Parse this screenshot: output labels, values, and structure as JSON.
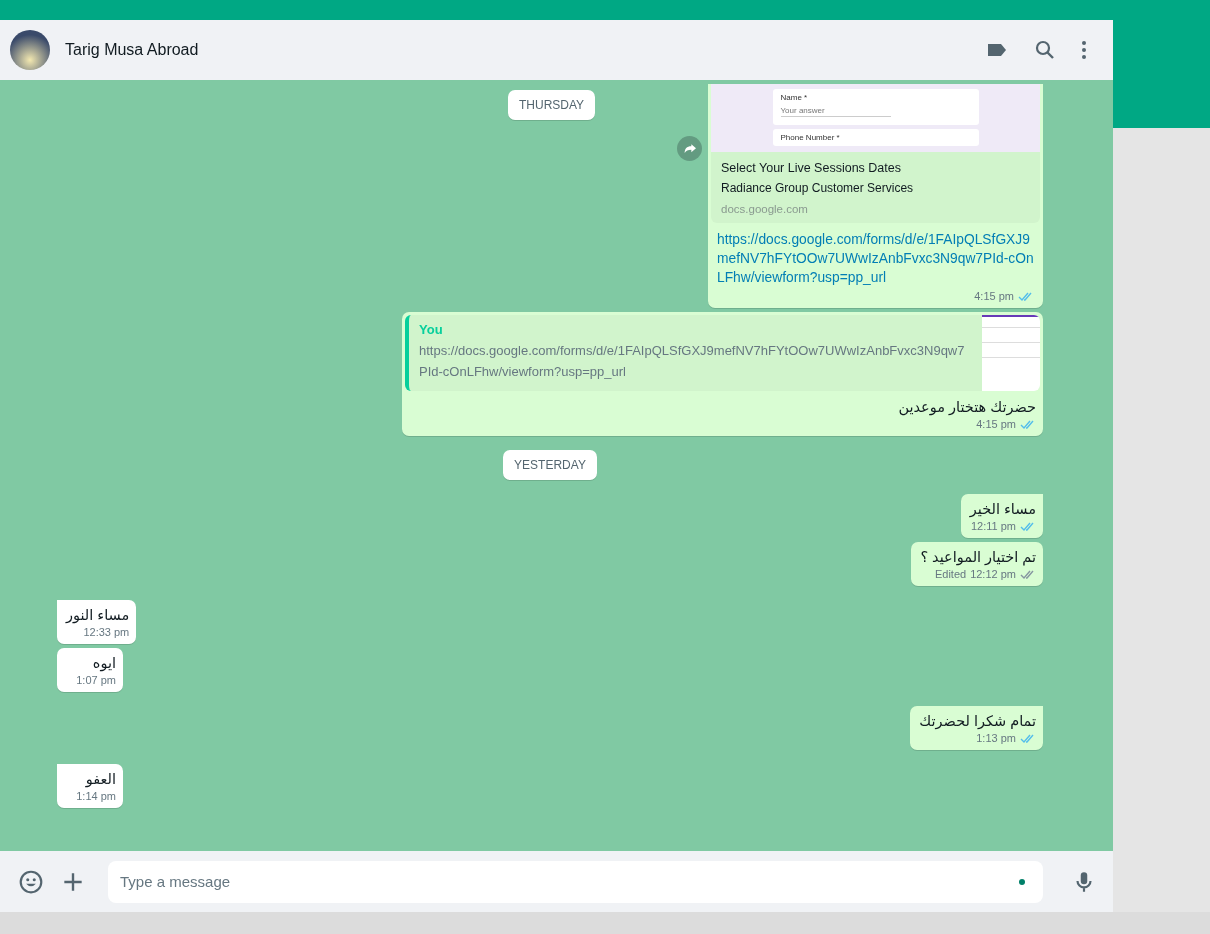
{
  "header": {
    "contact_name": "Tarig Musa Abroad"
  },
  "sticky_date": "THURSDAY",
  "messages": [
    {
      "kind": "link",
      "outgoing": true,
      "tail": false,
      "preview": {
        "form_fields": [
          {
            "label": "Name *",
            "placeholder": "Your answer"
          },
          {
            "label": "Phone Number *"
          }
        ],
        "title": "Select Your Live Sessions Dates",
        "subtitle": "Radiance Group Customer Services",
        "domain": "docs.google.com"
      },
      "text": "https://docs.google.com/forms/d/e/1FAIpQLSfGXJ9mefNV7hFYtOOw7UWwIzAnbFvxc3N9qw7PId-cOnLFhw/viewform?usp=pp_url",
      "time": "4:15 pm",
      "read": true
    },
    {
      "kind": "reply",
      "outgoing": true,
      "tail": false,
      "quote": {
        "author": "You",
        "text": "https://docs.google.com/forms/d/e/1FAIpQLSfGXJ9mefNV7hFYtOOw7UWwIzAnbFvxc3N9qw7PId-cOnLFhw/viewform?usp=pp_url"
      },
      "text": "حضرتك هتختار موعدين",
      "time": "4:15 pm",
      "read": true
    },
    {
      "kind": "date",
      "text": "YESTERDAY"
    },
    {
      "kind": "text",
      "outgoing": true,
      "tail": true,
      "text": "مساء الخير",
      "time": "12:11 pm",
      "read": true
    },
    {
      "kind": "text",
      "outgoing": true,
      "tail": false,
      "text": "تم اختيار المواعيد ؟",
      "edited": "Edited",
      "time": "12:12 pm",
      "read": false
    },
    {
      "kind": "text",
      "outgoing": false,
      "tail": true,
      "text": "مساء النور",
      "time": "12:33 pm"
    },
    {
      "kind": "text",
      "outgoing": false,
      "tail": false,
      "text": "ايوه",
      "time": "1:07 pm"
    },
    {
      "kind": "text",
      "outgoing": true,
      "tail": true,
      "text": "تمام شكرا لحضرتك",
      "time": "1:13 pm",
      "read": true
    },
    {
      "kind": "text",
      "outgoing": false,
      "tail": true,
      "text": "العفو",
      "time": "1:14 pm"
    }
  ],
  "composer": {
    "placeholder": "Type a message"
  }
}
